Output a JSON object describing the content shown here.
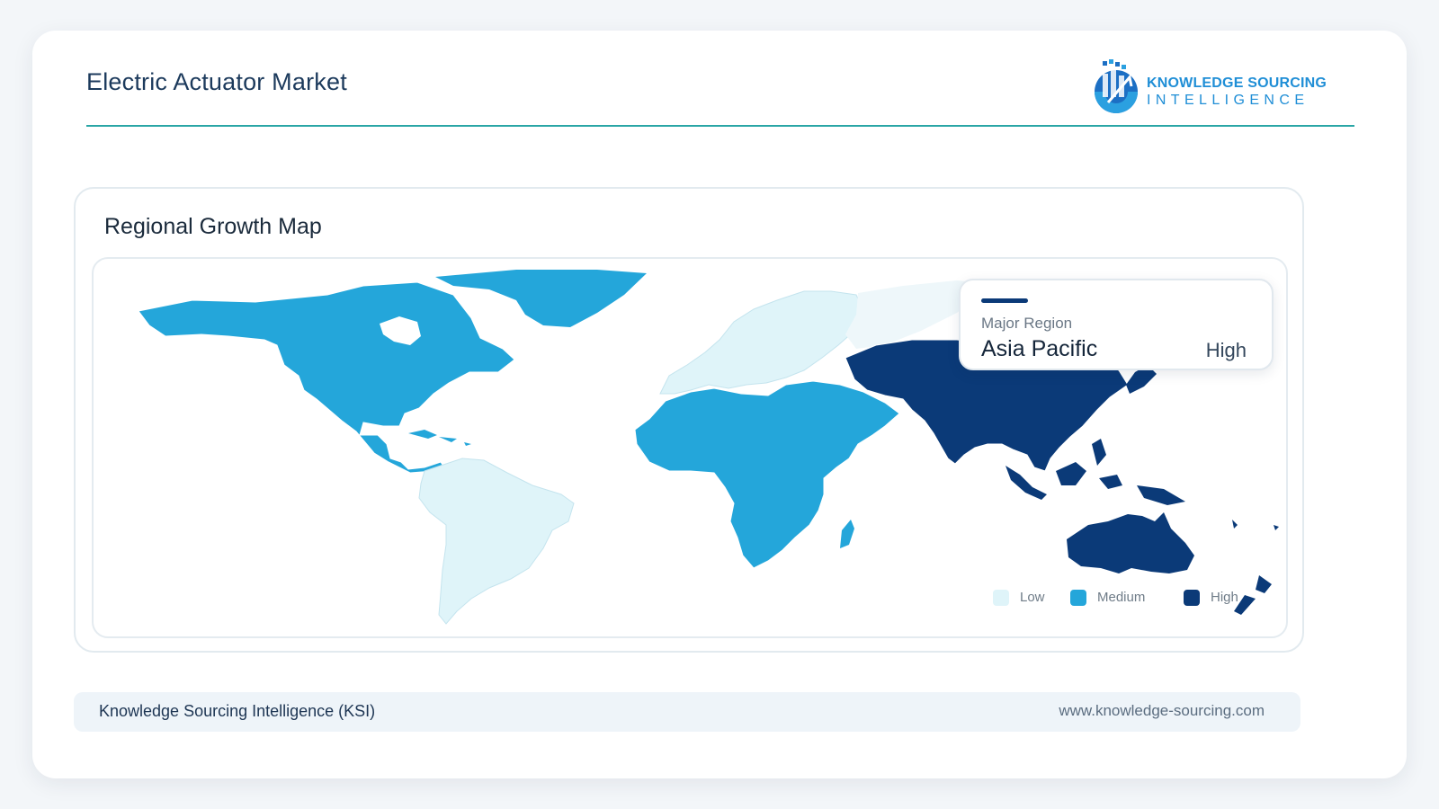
{
  "header": {
    "title": "Electric Actuator Market"
  },
  "logo": {
    "line1": "KNOWLEDGE SOURCING",
    "line2": "INTELLIGENCE"
  },
  "panel": {
    "title": "Regional Growth Map"
  },
  "info_card": {
    "label": "Major Region",
    "region": "Asia Pacific",
    "level": "High"
  },
  "legend": [
    {
      "label": "Low",
      "color": "#dff4f9"
    },
    {
      "label": "Medium",
      "color": "#24a6da"
    },
    {
      "label": "High",
      "color": "#0b3a78"
    }
  ],
  "regions": [
    {
      "name": "North America",
      "level": "Medium"
    },
    {
      "name": "South America",
      "level": "Low"
    },
    {
      "name": "Europe",
      "level": "Low"
    },
    {
      "name": "Middle East and Africa",
      "level": "Medium"
    },
    {
      "name": "Asia Pacific",
      "level": "High"
    }
  ],
  "footer": {
    "left": "Knowledge Sourcing Intelligence (KSI)",
    "right": "www.knowledge-sourcing.com"
  }
}
